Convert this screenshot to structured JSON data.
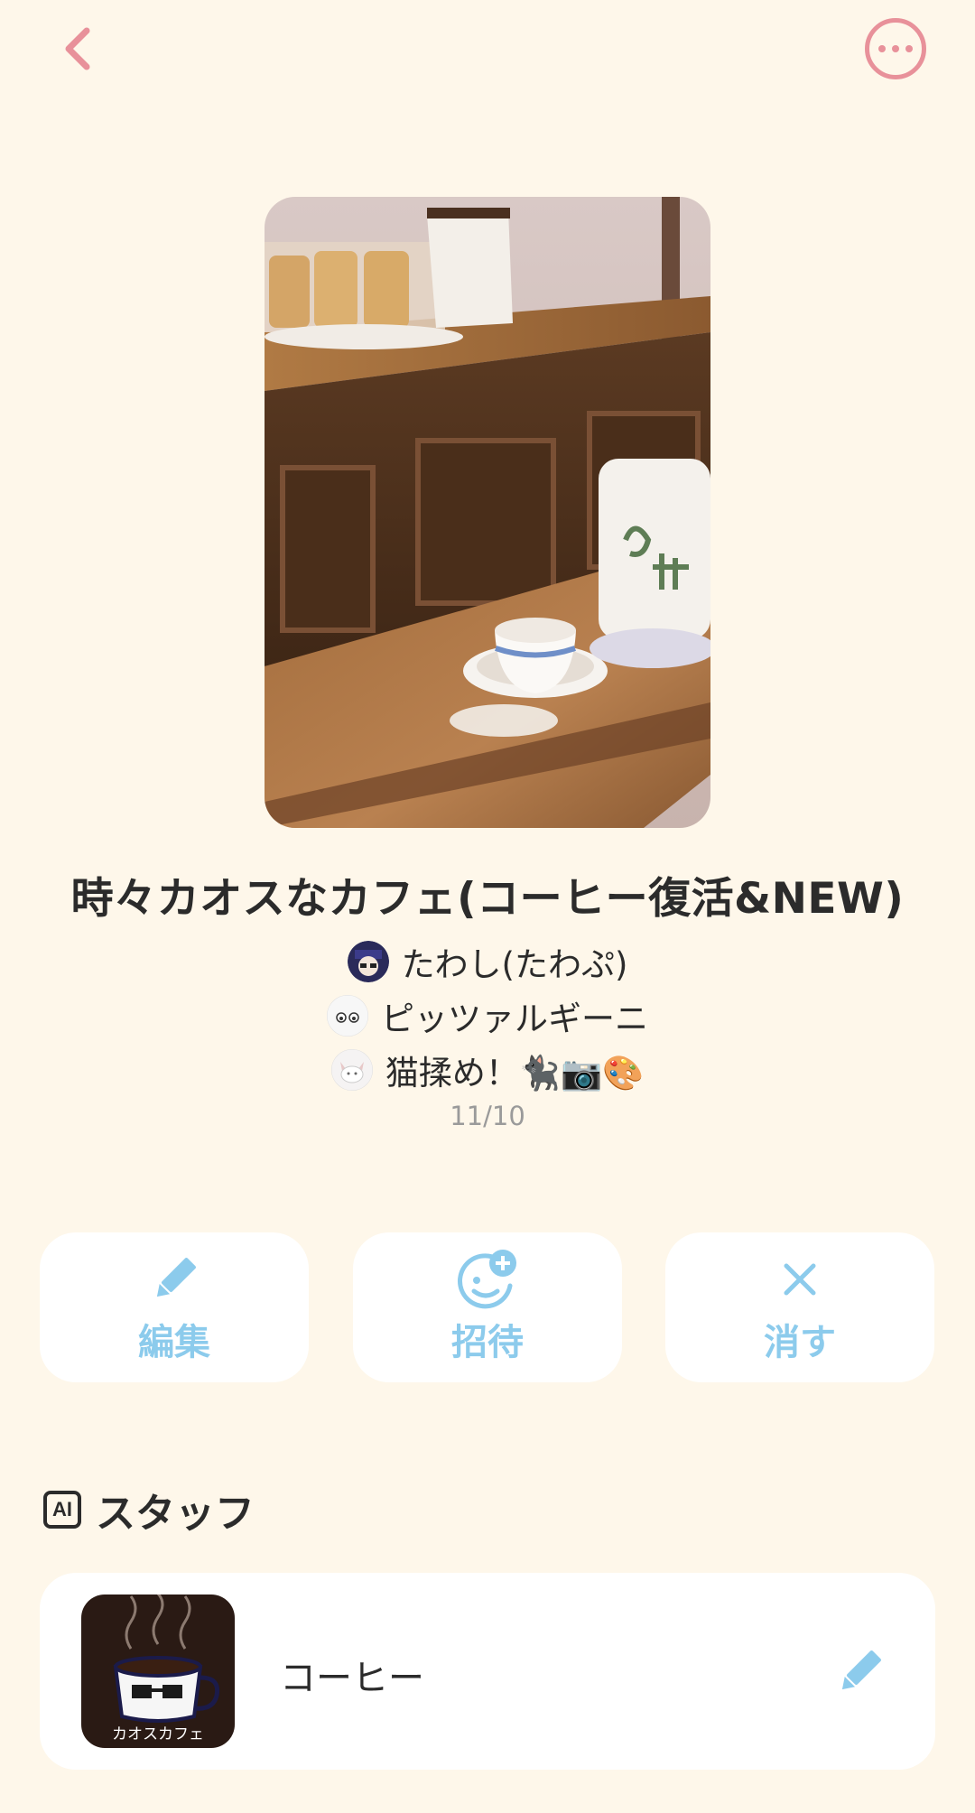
{
  "colors": {
    "background": "#FEF7EA",
    "accent_pink": "#E8919A",
    "accent_blue": "#8CCBEC",
    "card": "#FFFFFF",
    "text": "#2B2B2B",
    "subtext": "#9A9A9A"
  },
  "header": {
    "back_icon": "chevron-left-icon",
    "more_icon": "more-horizontal-icon"
  },
  "room": {
    "title": "時々カオスなカフェ(コーヒー復活&NEW)",
    "members": [
      {
        "name": "たわし(たわぷ)",
        "avatar": "avatar-dark-character"
      },
      {
        "name": "ピッツァルギーニ",
        "avatar": "avatar-white-face"
      },
      {
        "name": "猫揉め！🐈‍⬛📷🎨",
        "avatar": "avatar-white-cat"
      }
    ],
    "date": "11/10"
  },
  "actions": [
    {
      "label": "編集",
      "icon": "pencil-icon"
    },
    {
      "label": "招待",
      "icon": "add-user-icon"
    },
    {
      "label": "消す",
      "icon": "close-icon"
    }
  ],
  "staff": {
    "badge": "AI",
    "title": "スタッフ",
    "items": [
      {
        "name": "コーヒー",
        "avatar_text": "カオスカフェ",
        "edit_icon": "pencil-icon"
      }
    ]
  }
}
